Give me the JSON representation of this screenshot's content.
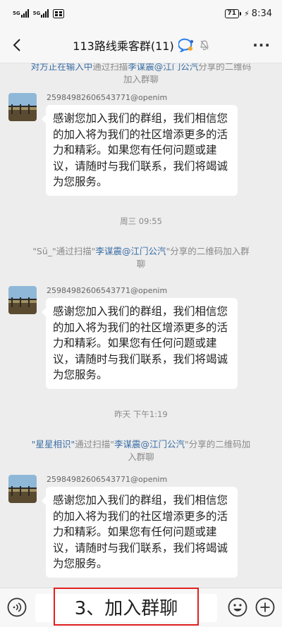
{
  "status_bar": {
    "sig1": "5G",
    "sig2": "5G",
    "battery": "71",
    "time": "8:34"
  },
  "header": {
    "title": "113路线乘客群(11)"
  },
  "messages": {
    "partial_notice": {
      "prefix": "对方正在输入中",
      "mid": "通过扫描",
      "inviter": "李谋震@江门公汽",
      "suffix": "分享的二维码加入群聊"
    },
    "sender_id": "25984982606543771@openim",
    "bubble_text": "感谢您加入我们的群组，我们相信您的加入将为我们的社区增添更多的活力和精彩。如果您有任何问题或建议，请随时与我们联系，我们将竭诚为您服务。",
    "time1": "周三 09:55",
    "notice2": {
      "name": "\"Sū_\"",
      "mid": "通过扫描\"",
      "inviter": "李谋震@江门公汽",
      "suffix": "\"分享的二维码加入群聊"
    },
    "time2": "昨天 下午1:19",
    "notice3": {
      "name": "\"星星相识\"",
      "mid": "通过扫描\"",
      "inviter": "李谋震@江门公汽",
      "suffix": "\"分享的二维码加入群聊"
    }
  },
  "annotation": "3、加入群聊",
  "colors": {
    "link": "#3a6ea5",
    "annotation_border": "#e02020",
    "background": "#ededed"
  }
}
